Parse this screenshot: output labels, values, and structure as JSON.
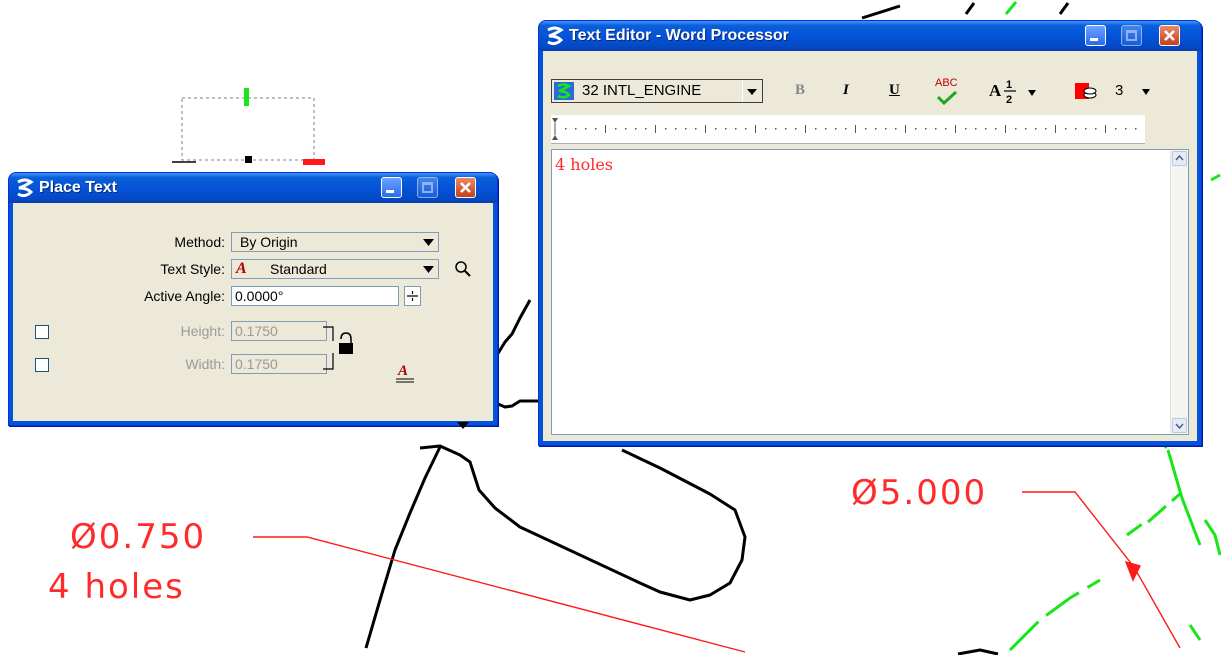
{
  "drawing": {
    "dim1_value": "Ø0.750",
    "dim1_note": "4 holes",
    "dim2_value": "Ø5.000"
  },
  "place_text": {
    "title": "Place Text",
    "method_label": "Method:",
    "method_value": "By Origin",
    "text_style_label": "Text Style:",
    "text_style_value": "Standard",
    "active_angle_label": "Active Angle:",
    "active_angle_value": "0.0000°",
    "height_label": "Height:",
    "height_value": "0.1750",
    "width_label": "Width:",
    "width_value": "0.1750"
  },
  "text_editor": {
    "title": "Text Editor - Word Processor",
    "font_value": "32 INTL_ENGINE",
    "bold_label": "B",
    "italic_label": "I",
    "underline_label": "U",
    "spell_label": "ABC",
    "fraction_label": "A",
    "color_value": "3",
    "content": "4 holes"
  },
  "colors": {
    "cad_red": "#ff2a2a",
    "cad_green": "#19e619",
    "xp_blue": "#0553d9"
  }
}
